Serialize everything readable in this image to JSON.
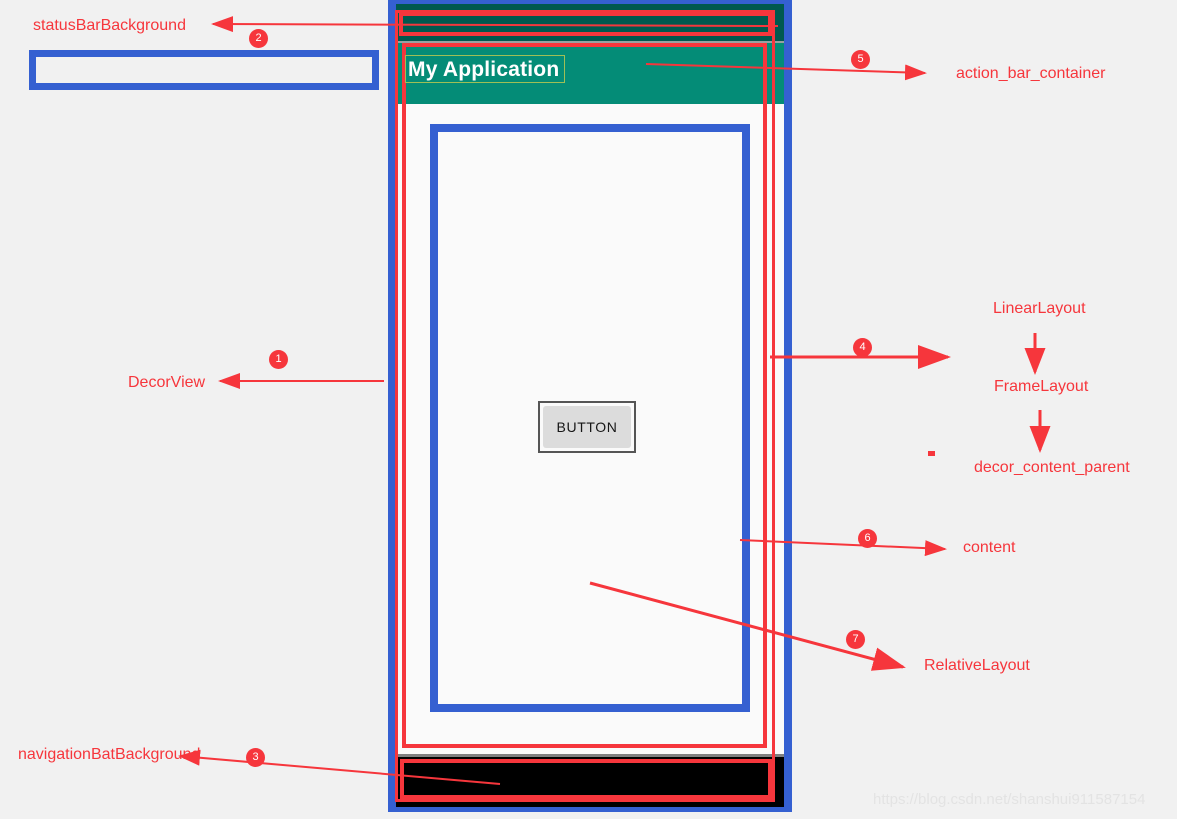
{
  "device": {
    "app_title": "My Application",
    "button_label": "BUTTON"
  },
  "annotations": [
    {
      "id": 1,
      "marker": "1",
      "label": "DecorView"
    },
    {
      "id": 2,
      "marker": "2",
      "label": "statusBarBackground"
    },
    {
      "id": 3,
      "marker": "3",
      "label": "navigationBatBackground"
    },
    {
      "id": 4,
      "marker": "4",
      "label": "LinearLayout"
    },
    {
      "id": 5,
      "marker": "5",
      "label": "action_bar_container"
    },
    {
      "id": 6,
      "marker": "6",
      "label": "content"
    },
    {
      "id": 7,
      "marker": "7",
      "label": "RelativeLayout"
    }
  ],
  "hierarchy_chain": {
    "level1": "LinearLayout",
    "level2": "FrameLayout",
    "level3": "decor_content_parent"
  },
  "watermark": "https://blog.csdn.net/shanshui911587154",
  "colors": {
    "annotation_red": "#f6363c",
    "frame_blue": "#3560d1",
    "action_bar_teal": "#048c77",
    "status_bar_teal": "#00594f",
    "nav_bar_black": "#000000",
    "page_background": "#f1f1f1"
  }
}
